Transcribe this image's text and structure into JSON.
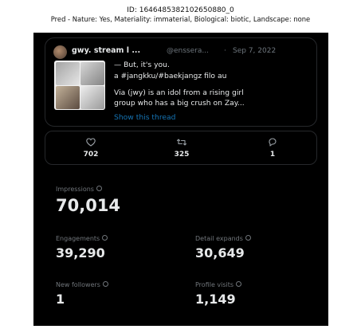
{
  "header": {
    "id_line": "ID: 1646485382102650880_0",
    "pred_line": "Pred - Nature: Yes, Materiality: immaterial, Biological: biotic, Landscape: none"
  },
  "tweet": {
    "author": "gwy. stream l ...",
    "handle": "@enssera...",
    "separator": "·",
    "date": "Sep 7, 2022",
    "line1": "— But, it's you.",
    "line2": "a #jangkku/#baekjangz filo au",
    "line3": "Via (jwy) is an idol from a rising girl",
    "line4": "group who has a big crush on Zay...",
    "show_thread": "Show this thread"
  },
  "engagement": {
    "likes": "702",
    "retweets": "325",
    "replies": "1"
  },
  "metrics": {
    "impressions": {
      "label": "Impressions",
      "value": "70,014"
    },
    "engagements": {
      "label": "Engagements",
      "value": "39,290"
    },
    "detail_expands": {
      "label": "Detail expands",
      "value": "30,649"
    },
    "new_followers": {
      "label": "New followers",
      "value": "1"
    },
    "profile_visits": {
      "label": "Profile visits",
      "value": "1,149"
    }
  },
  "colors": {
    "background": "#000000",
    "text": "#e7e9ea",
    "muted": "#71767b",
    "link": "#1d9bf0",
    "border": "#26282b"
  }
}
